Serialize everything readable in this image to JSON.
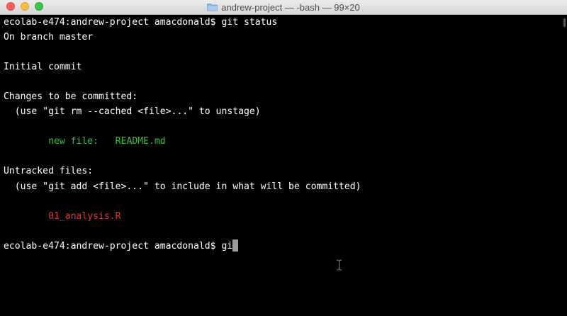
{
  "window": {
    "title": "andrew-project — -bash — 99×20",
    "controls": [
      "close",
      "minimize",
      "zoom"
    ],
    "icon": "folder-icon"
  },
  "terminal": {
    "colors": {
      "background": "#000000",
      "foreground": "#ffffff",
      "staged": "#3bbf3b",
      "untracked": "#d93a3a"
    },
    "prompt": "ecolab-e474:andrew-project amacdonald$ ",
    "command": "git status",
    "branch_line": "On branch master",
    "initial_commit": "Initial commit",
    "changes_header": "Changes to be committed:",
    "changes_hint": "  (use \"git rm --cached <file>...\" to unstage)",
    "staged_file": "\tnew file:   README.md",
    "untracked_header": "Untracked files:",
    "untracked_hint": "  (use \"git add <file>...\" to include in what will be committed)",
    "untracked_file": "\t01_analysis.R",
    "current_input": "gi"
  }
}
